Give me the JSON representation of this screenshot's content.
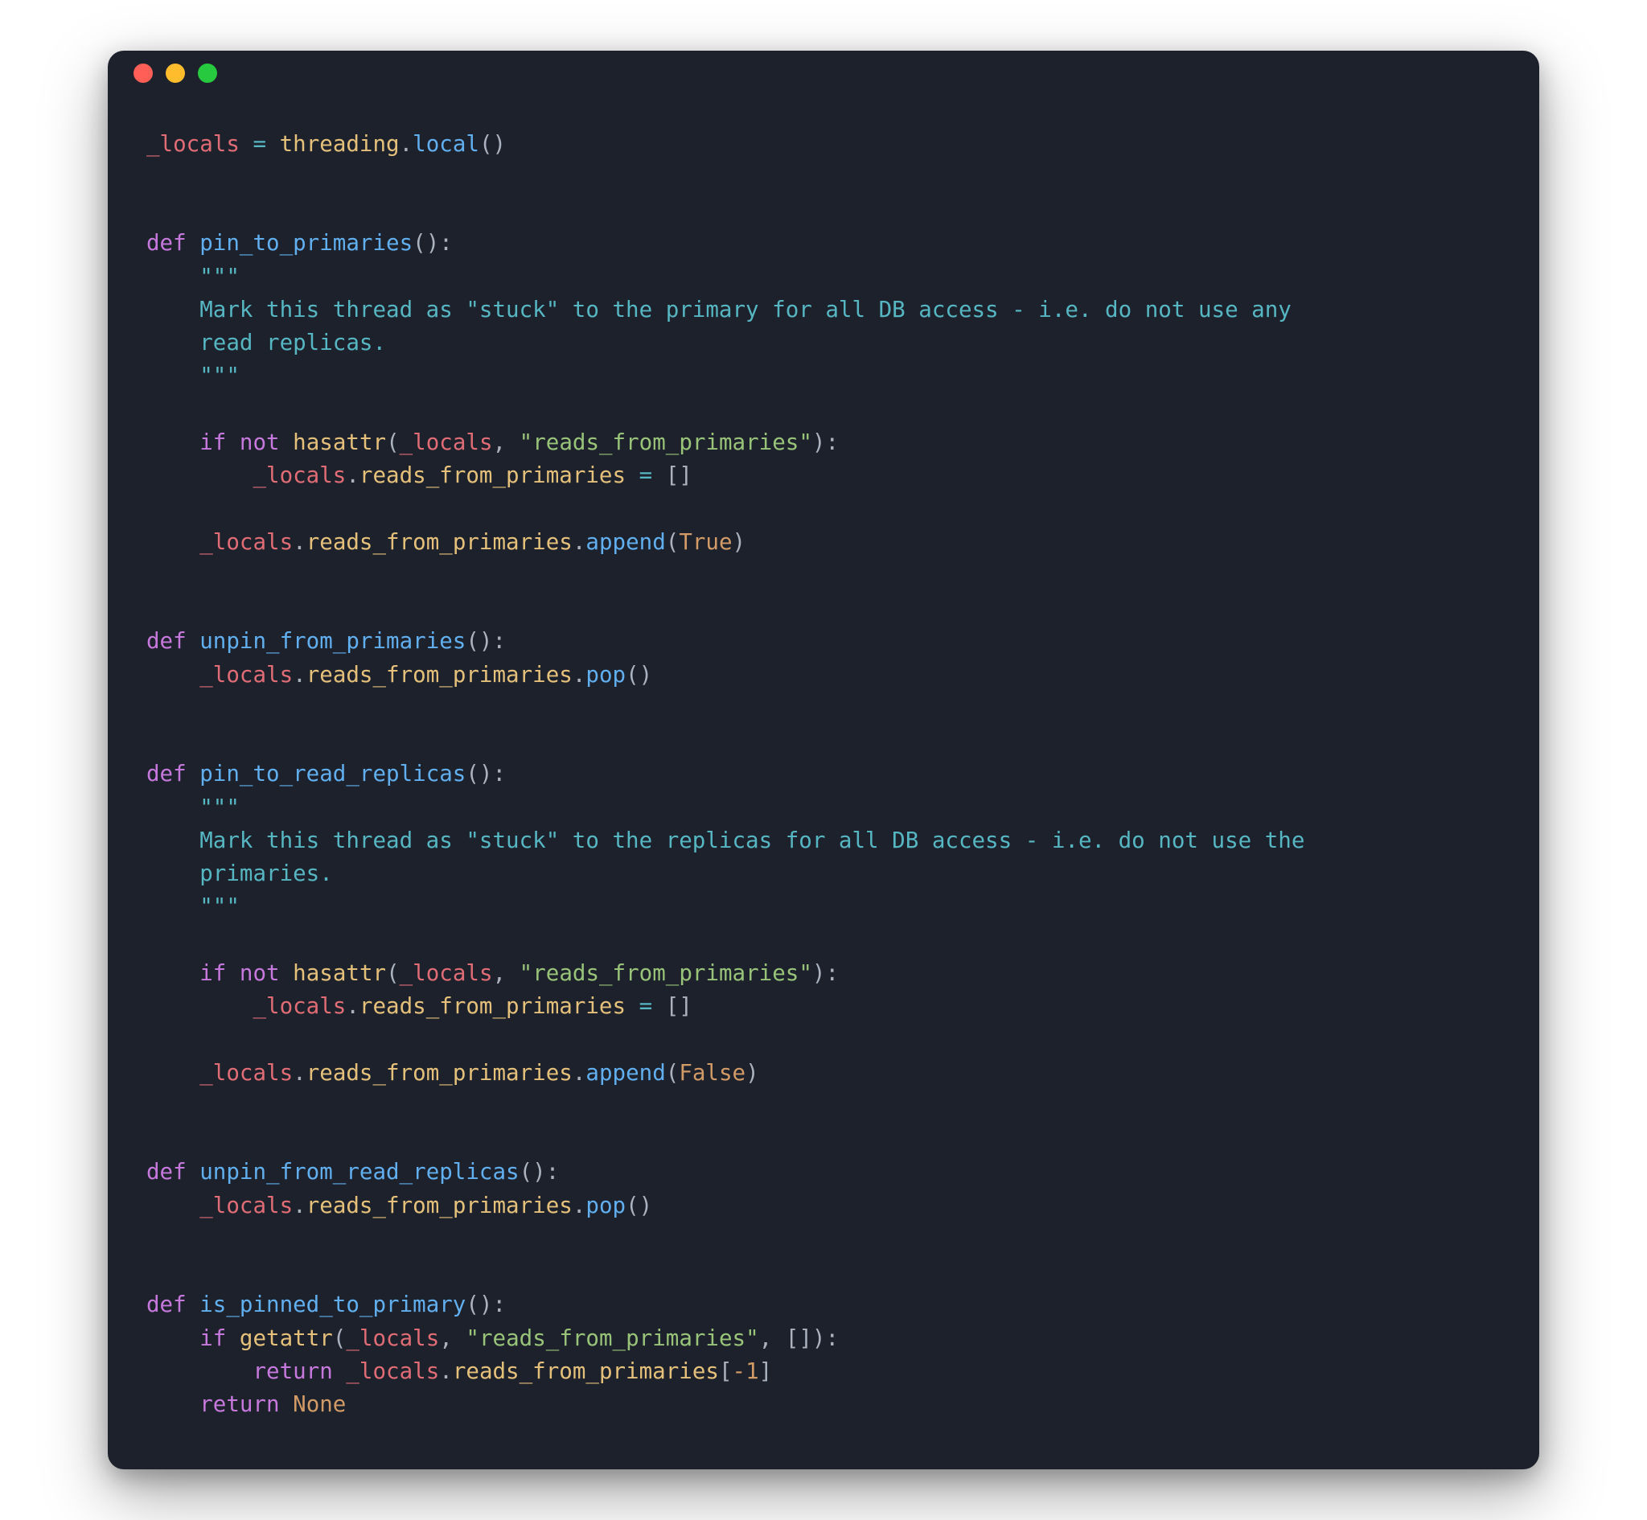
{
  "window": {
    "traffic_lights": [
      "close",
      "minimize",
      "zoom"
    ]
  },
  "code": {
    "line1": {
      "var": "_locals",
      "eq": "=",
      "mod": "threading",
      "dot": ".",
      "fn": "local",
      "parens": "()"
    },
    "fn1": {
      "def": "def",
      "name": "pin_to_primaries",
      "sig": "():",
      "doc_open": "    \"\"\"",
      "doc_l1": "    Mark this thread as \"stuck\" to the primary for all DB access - i.e. do not use any",
      "doc_l2": "    read replicas.",
      "doc_close": "    \"\"\"",
      "if_kw": "if",
      "not_kw": "not",
      "hasattr": "hasattr",
      "arg1": "_locals",
      "comma": ",",
      "arg2": "\"reads_from_primaries\"",
      "colon": "):",
      "assign_ind": "        ",
      "assign_obj": "_locals",
      "assign_dot": ".",
      "assign_attr": "reads_from_primaries",
      "assign_eq": " = []",
      "append_ind": "    ",
      "append_obj": "_locals",
      "append_attr": "reads_from_primaries",
      "append_fn": "append",
      "append_arg": "True"
    },
    "fn2": {
      "def": "def",
      "name": "unpin_from_primaries",
      "sig": "():",
      "body_obj": "_locals",
      "body_attr": "reads_from_primaries",
      "body_fn": "pop"
    },
    "fn3": {
      "def": "def",
      "name": "pin_to_read_replicas",
      "sig": "():",
      "doc_open": "    \"\"\"",
      "doc_l1": "    Mark this thread as \"stuck\" to the replicas for all DB access - i.e. do not use the",
      "doc_l2": "    primaries.",
      "doc_close": "    \"\"\"",
      "if_kw": "if",
      "not_kw": "not",
      "hasattr": "hasattr",
      "arg1": "_locals",
      "arg2": "\"reads_from_primaries\"",
      "assign_obj": "_locals",
      "assign_attr": "reads_from_primaries",
      "append_obj": "_locals",
      "append_attr": "reads_from_primaries",
      "append_fn": "append",
      "append_arg": "False"
    },
    "fn4": {
      "def": "def",
      "name": "unpin_from_read_replicas",
      "sig": "():",
      "body_obj": "_locals",
      "body_attr": "reads_from_primaries",
      "body_fn": "pop"
    },
    "fn5": {
      "def": "def",
      "name": "is_pinned_to_primary",
      "sig": "():",
      "if_kw": "if",
      "getattr": "getattr",
      "arg1": "_locals",
      "arg2": "\"reads_from_primaries\"",
      "arg3": "[]",
      "ret1_kw": "return",
      "ret1_obj": "_locals",
      "ret1_attr": "reads_from_primaries",
      "ret1_idx_open": "[",
      "ret1_idx": "-1",
      "ret1_idx_close": "]",
      "ret2_kw": "return",
      "ret2_val": "None"
    }
  }
}
